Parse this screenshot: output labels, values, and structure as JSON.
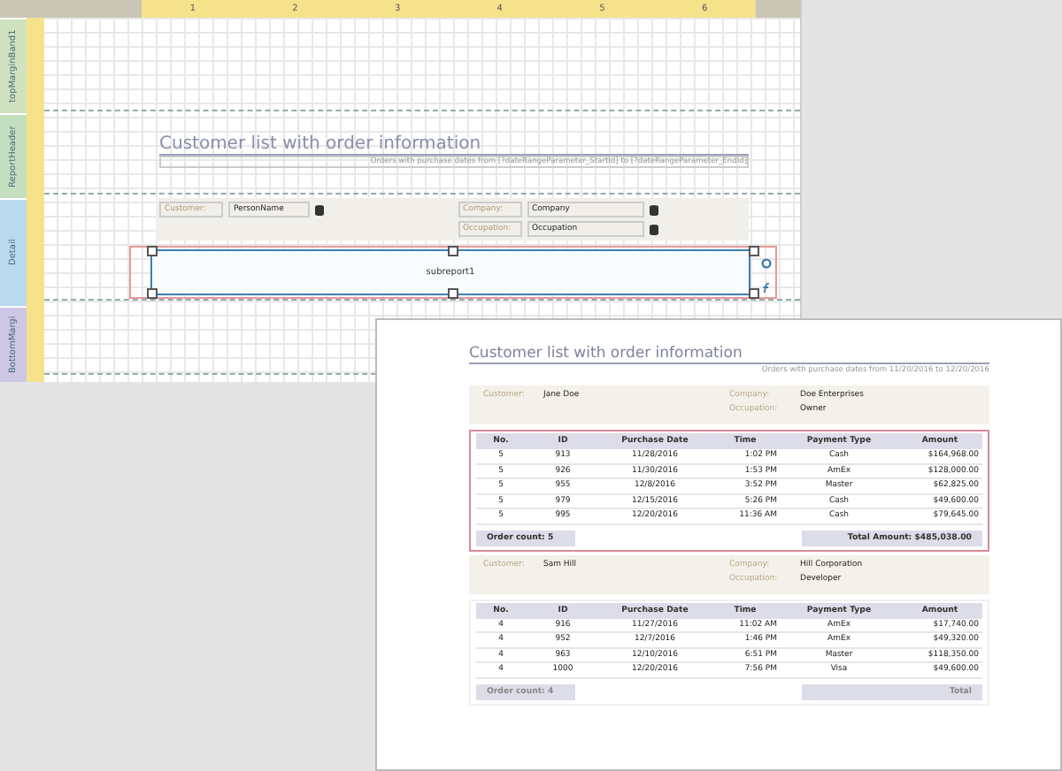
{
  "designer": {
    "ruler_marks": [
      "1",
      "2",
      "3",
      "4",
      "5",
      "6"
    ],
    "bands": [
      {
        "label": "topMarginBand1",
        "kind": "margin"
      },
      {
        "label": "ReportHeader",
        "kind": "header"
      },
      {
        "label": "Detail",
        "kind": "detail"
      },
      {
        "label": "BottomMargi",
        "kind": "bottom"
      }
    ],
    "title": "Customer list with order information",
    "subtitle": "Orders with purchase dates from [?dateRangeParameter_StartId] to [?dateRangeParameter_EndId]",
    "customer_label": "Customer:",
    "customer_field": "PersonName",
    "company_label": "Company:",
    "company_field": "Company",
    "occupation_label": "Occupation:",
    "occupation_field": "Occupation",
    "subreport": {
      "label": "subreport1",
      "selected": true
    }
  },
  "preview": {
    "title": "Customer list with order information",
    "subtitle": "Orders with purchase dates from 11/20/2016 to 12/20/2016",
    "groups": [
      {
        "customer_label": "Customer:",
        "customer": "Jane Doe",
        "company_label": "Company:",
        "company": "Doe Enterprises",
        "occupation_label": "Occupation:",
        "occupation": "Owner",
        "highlighted": true,
        "columns": [
          "No.",
          "ID",
          "Purchase Date",
          "Time",
          "Payment Type",
          "Amount"
        ],
        "rows": [
          [
            "5",
            "913",
            "11/28/2016",
            "1:02 PM",
            "Cash",
            "$164,968.00"
          ],
          [
            "5",
            "926",
            "11/30/2016",
            "1:53 PM",
            "AmEx",
            "$128,000.00"
          ],
          [
            "5",
            "955",
            "12/8/2016",
            "3:52 PM",
            "Master",
            "$62,825.00"
          ],
          [
            "5",
            "979",
            "12/15/2016",
            "5:26 PM",
            "Cash",
            "$49,600.00"
          ],
          [
            "5",
            "995",
            "12/20/2016",
            "11:36 AM",
            "Cash",
            "$79,645.00"
          ]
        ],
        "count": "Order count: 5",
        "total": "Total Amount: $485,038.00"
      },
      {
        "customer_label": "Customer:",
        "customer": "Sam Hill",
        "company_label": "Company:",
        "company": "Hill Corporation",
        "occupation_label": "Occupation:",
        "occupation": "Developer",
        "highlighted": false,
        "columns": [
          "No.",
          "ID",
          "Purchase Date",
          "Time",
          "Payment Type",
          "Amount"
        ],
        "rows": [
          [
            "4",
            "916",
            "11/27/2016",
            "11:02 AM",
            "AmEx",
            "$17,740.00"
          ],
          [
            "4",
            "952",
            "12/7/2016",
            "1:46 PM",
            "AmEx",
            "$49,320.00"
          ],
          [
            "4",
            "963",
            "12/10/2016",
            "6:51 PM",
            "Master",
            "$118,350.00"
          ],
          [
            "4",
            "1000",
            "12/20/2016",
            "7:56 PM",
            "Visa",
            "$49,600.00"
          ]
        ],
        "count": "Order count: 4",
        "total": "Total"
      }
    ]
  }
}
